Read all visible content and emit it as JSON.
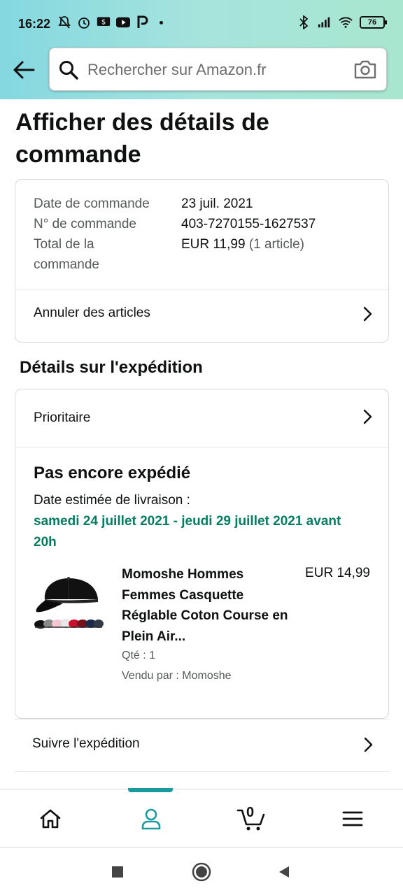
{
  "status_bar": {
    "time": "16:22",
    "battery": "76"
  },
  "search": {
    "placeholder": "Rechercher sur Amazon.fr"
  },
  "page": {
    "title": "Afficher des détails de commande"
  },
  "order_summary": {
    "date_label": "Date de commande",
    "date_value": "23 juil. 2021",
    "number_label": "N° de commande",
    "number_value": "403-7270155-1627537",
    "total_label": "Total de la commande",
    "total_value": "EUR 11,99",
    "total_count": "(1 article)",
    "cancel_label": "Annuler des articles"
  },
  "shipment": {
    "section_title": "Détails sur l'expédition",
    "speed_label": "Prioritaire",
    "status": "Pas encore expédié",
    "est_label": "Date estimée de livraison :",
    "est_date": "samedi 24 juillet 2021 - jeudi 29 juillet 2021 avant 20h",
    "track_label": "Suivre l'expédition"
  },
  "product": {
    "title": "Momoshe Hommes Femmes Casquette Réglable Coton Course en Plein Air...",
    "price": "EUR 14,99",
    "qty": "Qté : 1",
    "seller": "Vendu par : Momoshe",
    "icon": "cap-image"
  },
  "bottom_nav": {
    "cart_count": "0",
    "active": "account"
  },
  "colors": {
    "header_gradient_start": "#84d8e0",
    "header_gradient_end": "#a8e6cf",
    "delivery_green": "#067d62",
    "active_teal": "#1a9aa0"
  }
}
